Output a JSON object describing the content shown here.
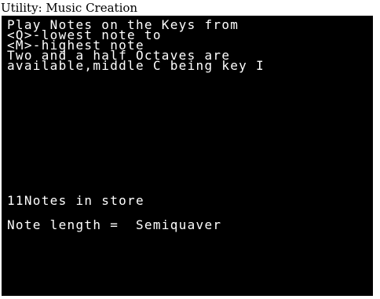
{
  "window": {
    "title": "Utility: Music Creation"
  },
  "screen": {
    "instructions": [
      "Play Notes on the Keys from",
      "<Q>-lowest note to",
      "<M>-highest note",
      "Two and a half Octaves are",
      "available,middle C being key I"
    ],
    "notes_in_store": "11Notes in store",
    "note_length": "Note length =  Semiquaver"
  },
  "colors": {
    "screen_background": "#000000",
    "text": "#ffffff"
  }
}
